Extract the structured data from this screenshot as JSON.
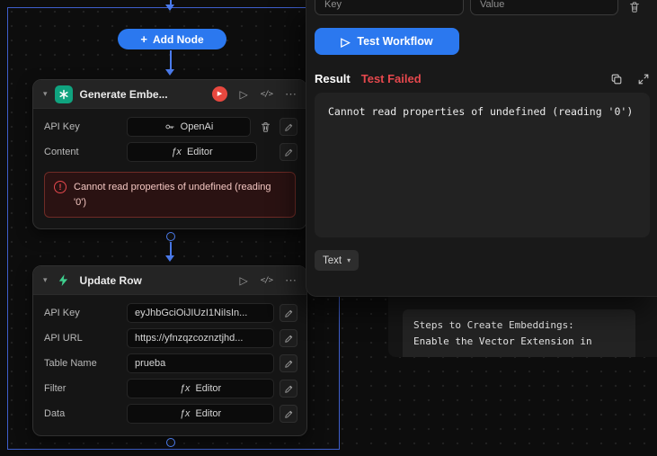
{
  "colors": {
    "accent_blue": "#2b78ef",
    "edge_blue": "#4b7bec",
    "error_red": "#e5484d",
    "openai_teal": "#10a37f",
    "supabase_green": "#3ecf8e"
  },
  "icons": {
    "plus": "+",
    "chevron_down": "▾",
    "play": "▷",
    "play_solid": "▶",
    "code": "</>",
    "more": "⋯",
    "fx": "ƒx",
    "exclaim": "!"
  },
  "canvas": {
    "add_node_label": "Add Node"
  },
  "node_generate": {
    "title": "Generate Embe...",
    "fields": [
      {
        "label": "API Key",
        "value": "OpenAi"
      },
      {
        "label": "Content",
        "value": "Editor"
      }
    ],
    "error": "Cannot read properties of undefined (reading '0')"
  },
  "node_update": {
    "title": "Update Row",
    "fields": [
      {
        "label": "API Key",
        "value": "eyJhbGciOiJIUzI1NiIsIn..."
      },
      {
        "label": "API URL",
        "value": "https://yfnzqzcoznztjhd..."
      },
      {
        "label": "Table Name",
        "value": "prueba"
      },
      {
        "label": "Filter",
        "value": "Editor"
      },
      {
        "label": "Data",
        "value": "Editor"
      }
    ]
  },
  "panel": {
    "key_placeholder": "Key",
    "value_placeholder": "Value",
    "test_button_label": "Test Workflow",
    "result_label": "Result",
    "result_status": "Test Failed",
    "output_text": "Cannot read properties of undefined (reading '0')",
    "format_label": "Text"
  },
  "background_node": {
    "code_line1": "Steps to Create Embeddings:",
    "code_line2": "Enable the Vector Extension in"
  }
}
